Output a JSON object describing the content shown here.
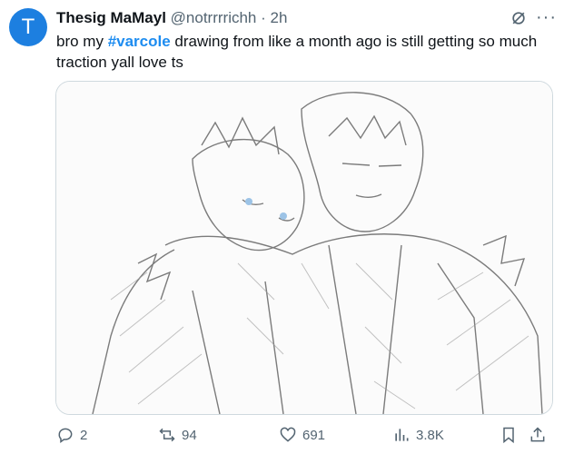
{
  "tweet": {
    "avatar_letter": "T",
    "display_name": "Thesig MaMayl",
    "handle": "@notrrrrichh",
    "separator": "·",
    "time": "2h",
    "text_before": "bro my ",
    "hashtag": "#varcole",
    "text_after": " drawing from like a month ago is still getting so much traction yall love ts",
    "more_icon": "more-dots-icon",
    "grok_icon": "grok-icon"
  },
  "actions": {
    "replies": "2",
    "reposts": "94",
    "likes": "691",
    "views": "3.8K"
  },
  "colors": {
    "avatar": "#1d7fe0",
    "hashtag": "#1d8cf0",
    "meta": "#536471"
  }
}
